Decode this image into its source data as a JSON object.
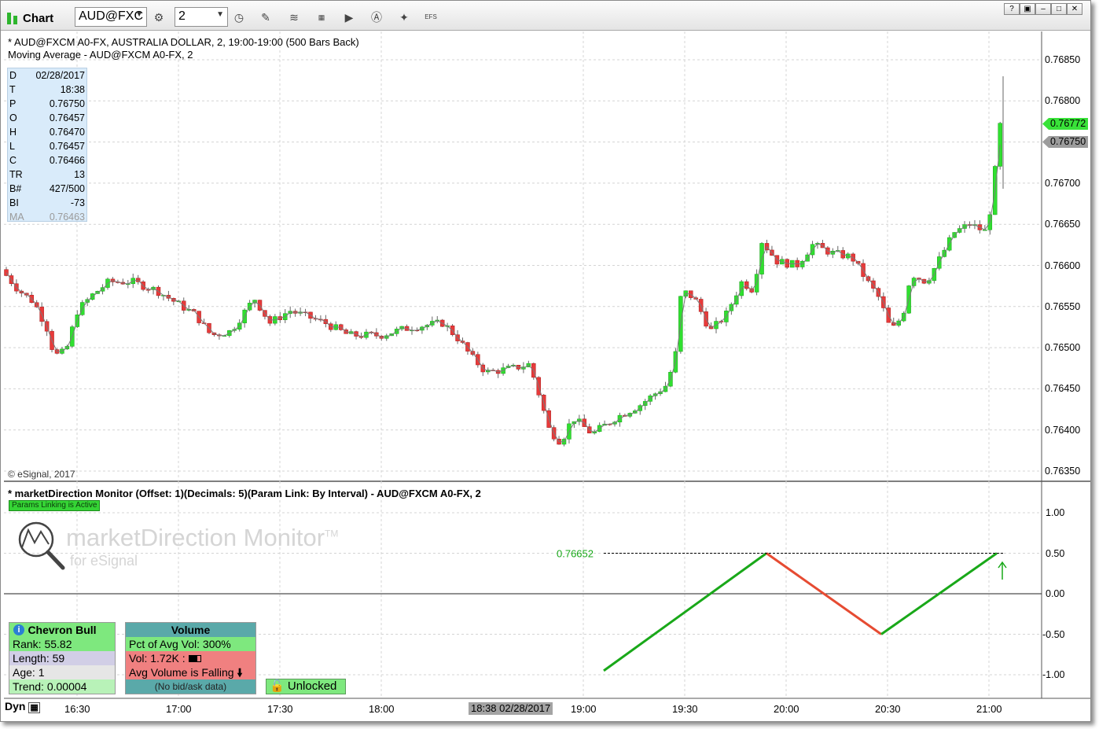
{
  "toolbar": {
    "title": "Chart",
    "symbol": "AUD@FXC",
    "interval": "2",
    "efs_label": "EFS",
    "window_buttons": [
      "?",
      "▣",
      "–",
      "□",
      "✕"
    ]
  },
  "price_pane": {
    "header1": "* AUD@FXCM A0-FX, AUSTRALIA DOLLAR, 2, 19:00-19:00 (500 Bars Back)",
    "header2": "Moving Average - AUD@FXCM A0-FX, 2",
    "copyright": "© eSignal, 2017",
    "price_labels": [
      "0.76850",
      "0.76800",
      "0.76750",
      "0.76700",
      "0.76650",
      "0.76600",
      "0.76550",
      "0.76500",
      "0.76450",
      "0.76400",
      "0.76350"
    ],
    "last_price_tag": "0.76772",
    "cursor_price_tag": "0.76750",
    "last_price_color": "#39e239"
  },
  "data_window": [
    {
      "k": "D",
      "v": "02/28/2017"
    },
    {
      "k": "T",
      "v": "18:38"
    },
    {
      "k": "P",
      "v": "0.76750"
    },
    {
      "k": "O",
      "v": "0.76457"
    },
    {
      "k": "H",
      "v": "0.76470"
    },
    {
      "k": "L",
      "v": "0.76457"
    },
    {
      "k": "C",
      "v": "0.76466"
    },
    {
      "k": "TR",
      "v": "13"
    },
    {
      "k": "B#",
      "v": "427/500"
    },
    {
      "k": "BI",
      "v": "-73"
    },
    {
      "k": "MA",
      "v": "0.76463"
    }
  ],
  "indicator_pane": {
    "header": "* marketDirection Monitor (Offset: 1)(Decimals: 5)(Param Link: By Interval) - AUD@FXCM A0-FX, 2",
    "params_badge": "Params Linking is Active",
    "logo_title": "marketDirection Monitor",
    "logo_tm": "TM",
    "logo_sub": "for eSignal",
    "level_label": "0.76652",
    "axis_labels": [
      "1.00",
      "0.50",
      "0.00",
      "-0.50",
      "-1.00"
    ],
    "up_color": "#19a819",
    "down_color": "#e64b32"
  },
  "chevron_panel": {
    "title": "Chevron Bull",
    "rank": "Rank: 55.82",
    "length": "Length: 59",
    "age": "Age: 1",
    "trend": "Trend: 0.00004"
  },
  "volume_panel": {
    "title": "Volume",
    "pct": "Pct of Avg Vol: 300%",
    "vol": "Vol: 1.72K :",
    "falling": "Avg Volume is Falling",
    "bidask": "(No bid/ask data)"
  },
  "lock_button": "Unlocked",
  "time_axis": {
    "dyn": "Dyn",
    "labels": [
      "16:30",
      "17:00",
      "17:30",
      "18:00",
      "19:00",
      "19:30",
      "20:00",
      "20:30",
      "21:00"
    ],
    "cursor": "18:38 02/28/2017"
  }
}
